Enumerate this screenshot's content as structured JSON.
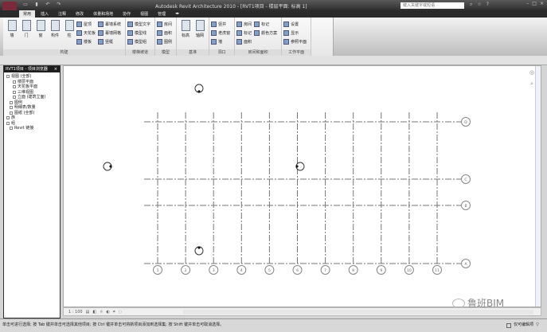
{
  "titlebar": {
    "title": "Autodesk Revit Architecture 2010 - [RVT1项目 - 楼层平面: 标高 1]",
    "search_placeholder": "键入关键字或短语",
    "window_controls": [
      "–",
      "□",
      "×"
    ]
  },
  "tabs": [
    "常用",
    "插入",
    "注释",
    "修改",
    "体量和场地",
    "协作",
    "视图",
    "管理",
    "◂▸"
  ],
  "ribbon": {
    "panels": [
      {
        "title": "构建",
        "big": [
          "墙",
          "门",
          "窗",
          "构件",
          "柱"
        ],
        "small": [
          "屋顶",
          "天花板",
          "楼板",
          "幕墙系统",
          "幕墙网格",
          "竖梃"
        ]
      },
      {
        "title": "楼梯坡道",
        "small": [
          "模型文字",
          "模型线",
          "模型组"
        ]
      },
      {
        "title": "模型",
        "small": [
          "房间",
          "面积",
          "图例"
        ]
      },
      {
        "title": "基准",
        "big": [
          "标高",
          "轴网"
        ]
      },
      {
        "title": "洞口",
        "small": [
          "竖井",
          "老虎窗",
          "墙"
        ]
      },
      {
        "title": "房间和面积",
        "small": [
          "房间",
          "标记",
          "面积",
          "标记",
          "颜色方案"
        ]
      },
      {
        "title": "工作平面",
        "small": [
          "设置",
          "显示",
          "参照平面"
        ]
      }
    ]
  },
  "browser": {
    "title": "RVT1项目 - 项目浏览器",
    "items": [
      "视图 (全部)",
      "楼层平面",
      "天花板平面",
      "三维视图",
      "立面 (建筑立面)",
      "图例",
      "明细表/数量",
      "图纸 (全部)",
      "族",
      "组",
      "Revit 链接"
    ]
  },
  "grid": {
    "columns": [
      "1",
      "2",
      "3",
      "4",
      "5",
      "6",
      "7",
      "8",
      "9",
      "10",
      "11"
    ],
    "rows": [
      "D",
      "C",
      "B",
      "A"
    ]
  },
  "viewbar": {
    "scale": "1 : 100"
  },
  "watermark": "鲁班BIM",
  "status": {
    "text": "单击可进行选择; 按 Tab 键并单击可选择其他项目; 按 Ctrl 键并单击可将新项目添加到选择集; 按 Shift 键并单击可取消选择。",
    "right": "仅可编辑项"
  }
}
